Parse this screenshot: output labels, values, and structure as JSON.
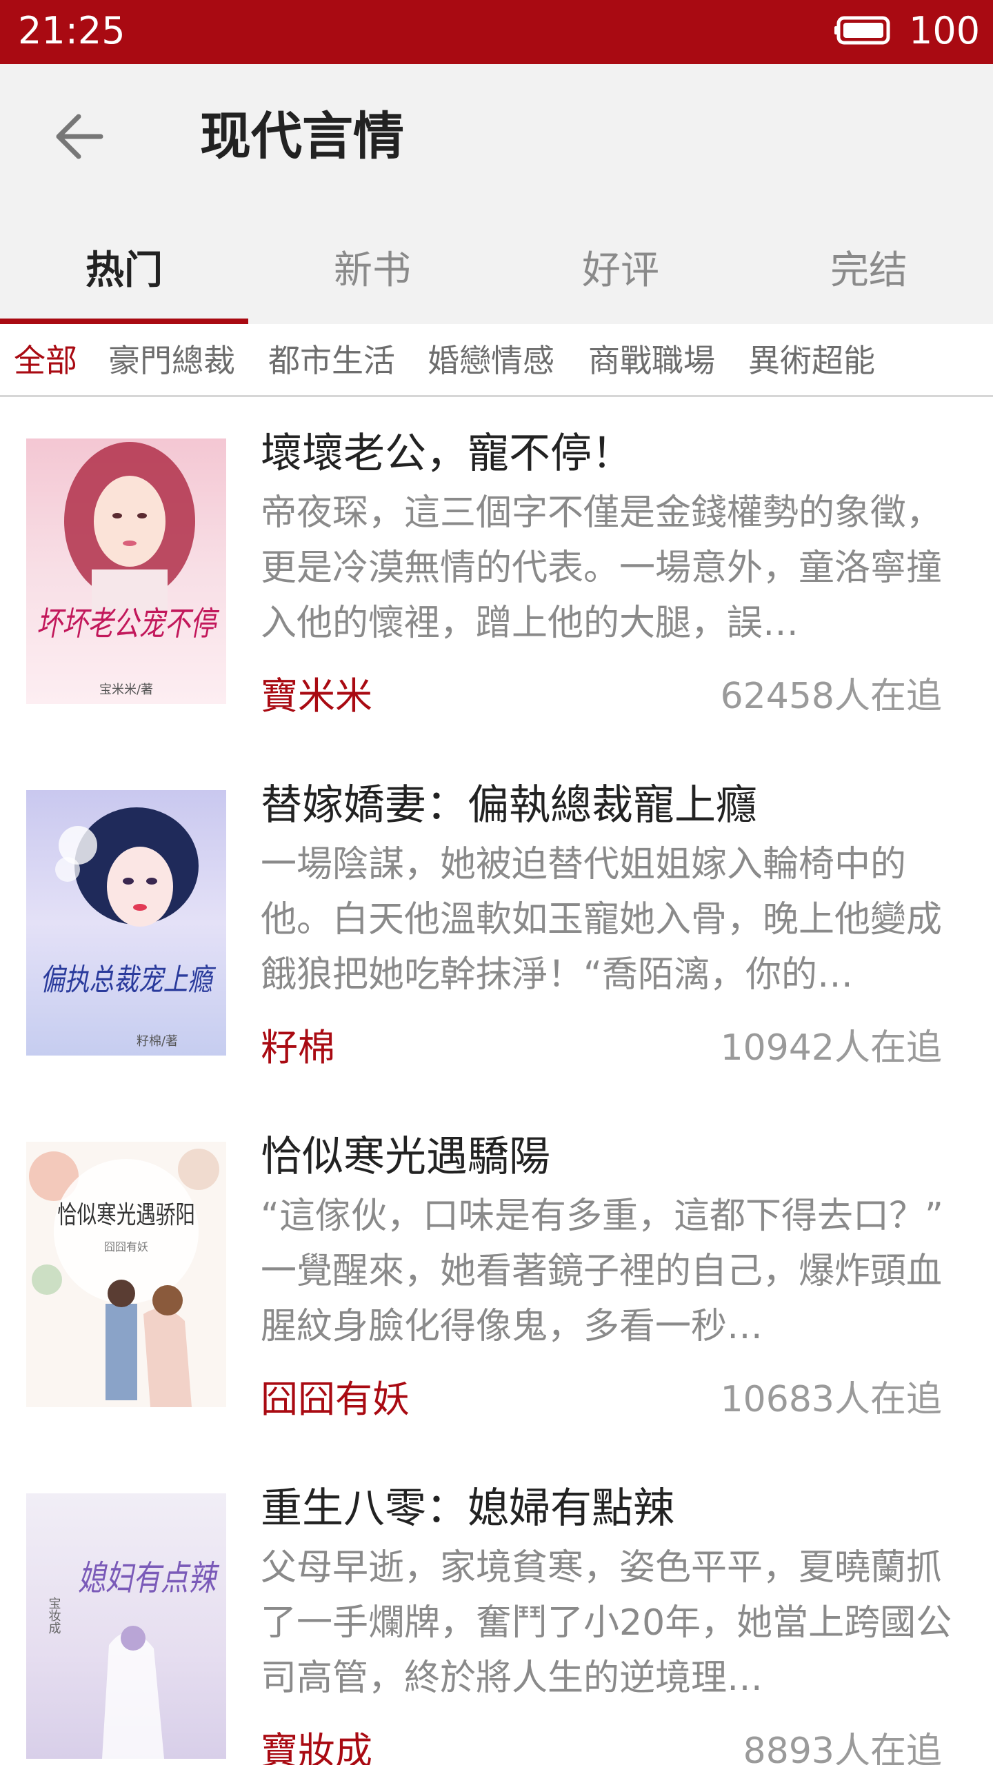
{
  "status_bar": {
    "time": "21:25",
    "battery_level": "100",
    "battery_icon": "battery-icon"
  },
  "app_bar": {
    "back_icon": "arrow-left-icon",
    "title": "现代言情"
  },
  "tabs": [
    {
      "label": "热门",
      "active": true
    },
    {
      "label": "新书",
      "active": false
    },
    {
      "label": "好评",
      "active": false
    },
    {
      "label": "完结",
      "active": false
    }
  ],
  "filters": [
    {
      "label": "全部",
      "active": true
    },
    {
      "label": "豪門總裁",
      "active": false
    },
    {
      "label": "都市生活",
      "active": false
    },
    {
      "label": "婚戀情感",
      "active": false
    },
    {
      "label": "商戰職場",
      "active": false
    },
    {
      "label": "異術超能",
      "active": false
    }
  ],
  "colors": {
    "accent": "#a90a12",
    "app_bar_bg": "#f2f2f2",
    "muted_text": "#8a8a8a"
  },
  "books": [
    {
      "title": "壞壞老公，寵不停！",
      "description": "帝夜琛，這三個字不僅是金錢權勢的象徵，更是冷漠無情的代表。一場意外，童洛寧撞入他的懷裡，蹭上他的大腿，誤…",
      "author": "寶米米",
      "followers": "62458人在追",
      "cover_title": "坏坏老公宠不停",
      "cover_author": "宝米米/著"
    },
    {
      "title": "替嫁嬌妻：偏執總裁寵上癮",
      "description": "一場陰謀，她被迫替代姐姐嫁入輪椅中的他。白天他溫軟如玉寵她入骨，晚上他變成餓狼把她吃幹抹淨！“喬陌漓，你的…",
      "author": "籽棉",
      "followers": "10942人在追",
      "cover_title": "偏执总裁宠上瘾",
      "cover_author": "籽棉/著"
    },
    {
      "title": "恰似寒光遇驕陽",
      "description": "“這傢伙，口味是有多重，這都下得去口？” 一覺醒來，她看著鏡子裡的自己，爆炸頭血腥紋身臉化得像鬼，多看一秒…",
      "author": "囧囧有妖",
      "followers": "10683人在追",
      "cover_title": "恰似寒光遇骄阳",
      "cover_author": "囧囧有妖"
    },
    {
      "title": "重生八零：媳婦有點辣",
      "description": "父母早逝，家境貧寒，姿色平平，夏曉蘭抓了一手爛牌，奮鬥了小20年，她當上跨國公司高管，終於將人生的逆境理…",
      "author": "寶妝成",
      "followers": "8893人在追",
      "cover_title": "媳妇有点辣",
      "cover_author": "宝妆成"
    }
  ]
}
